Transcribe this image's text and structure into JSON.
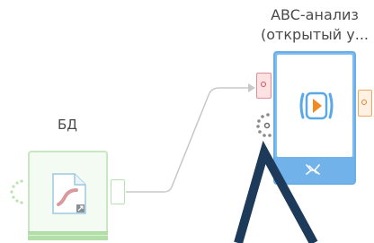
{
  "nodes": {
    "db": {
      "label": "БД",
      "icon": "document-chart-icon",
      "colors": {
        "border": "#c6e7bf",
        "fill": "#f4fbf2",
        "bar": "#b3e0a9"
      }
    },
    "abc": {
      "label_line1": "ABC-анализ",
      "label_line2": "(открытый у...",
      "icon": "run-play-icon",
      "footer_icon": "ribbon-icon",
      "colors": {
        "border": "#6aaee8",
        "fill": "#7fbcf0",
        "play": "#f08a24"
      }
    }
  },
  "ports": {
    "input_port_color": "#e68a93",
    "output_port_color": "#f0a762",
    "spinner_icon": "loading-spinner-icon"
  },
  "connection": {
    "color": "#c8c8c8",
    "arrow": "arrow-icon"
  },
  "overlay": {
    "shape": "cursor-arrow-outline",
    "color": "#1e3a5a"
  }
}
